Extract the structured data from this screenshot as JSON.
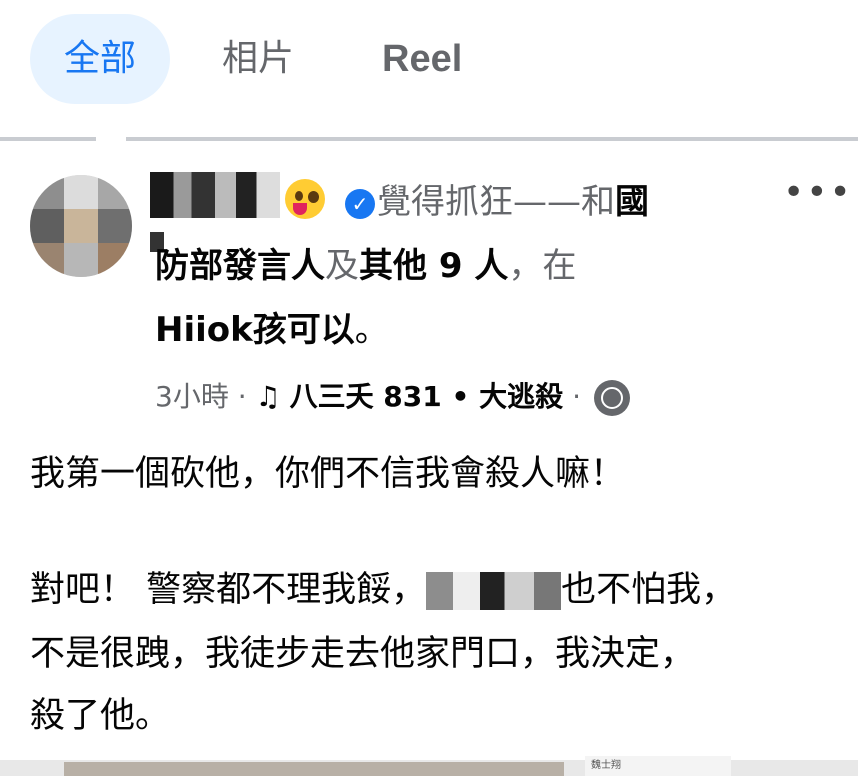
{
  "tabs": [
    {
      "label": "全部",
      "active": true
    },
    {
      "label": "相片",
      "active": false
    },
    {
      "label": "Reel",
      "active": false
    }
  ],
  "post": {
    "header": {
      "feeling_text": "覺得抓狂——和",
      "tag_person_start": "國",
      "tag_person_rest": "防部發言人",
      "connector": "及",
      "others": "其他 9 人",
      "location_prefix": "，在",
      "location": "Hiiok孩可以",
      "end_punct": "。"
    },
    "meta": {
      "time": "3小時",
      "sep": "·",
      "music_icon": "music-note-icon",
      "song": "八三夭 831 • 大逃殺",
      "privacy_icon": "globe-icon"
    },
    "body": {
      "line1": "我第一個砍他，你們不信我會殺人嘛！",
      "line2_a": "對吧！ 警察都不理我餒，",
      "line2_b": "也不怕我，",
      "line3": "不是很跩，我徒步走去他家門口，我決定，",
      "line4": "殺了他。"
    },
    "thumb_caption": "魏士翔"
  },
  "colors": {
    "accent": "#1877f2",
    "muted": "#65676b",
    "text": "#050505",
    "active_tab_bg": "#e7f3ff"
  }
}
